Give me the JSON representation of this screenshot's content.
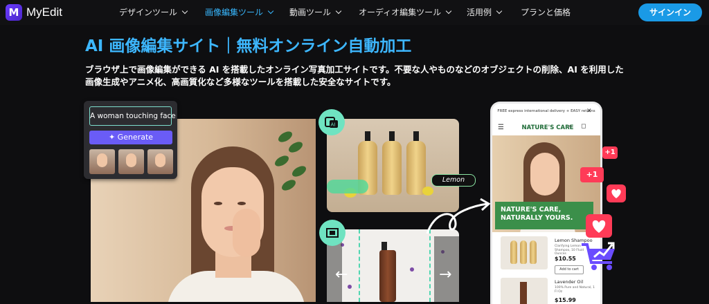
{
  "nav": {
    "logo_text": "MyEdit",
    "items": [
      {
        "label": "デザインツール"
      },
      {
        "label": "画像編集ツール"
      },
      {
        "label": "動画ツール"
      },
      {
        "label": "オーディオ編集ツール"
      },
      {
        "label": "活用例"
      },
      {
        "label": "プランと価格"
      }
    ],
    "signin_label": "サインイン"
  },
  "hero": {
    "title": "AI 画像編集サイト｜無料オンライン自動加工",
    "description": "ブラウザ上で画像編集ができる AI を搭載したオンライン写真加工サイトです。不要な人やものなどのオブジェクトの削除、AI を利用した 画像生成やアニメ化、高画質化など多様なツールを搭載した安全なサイトです。"
  },
  "generate_card": {
    "prompt_value": "A woman touching face",
    "generate_label": "Generate"
  },
  "product_card": {
    "tag_label": "Lemon"
  },
  "phone": {
    "topbar_text": "FREE express international delivery + EASY returns",
    "brand": "NATURE'S CARE",
    "banner_text": "NATURE'S CARE, NATURALLY YOURS.",
    "products": [
      {
        "name": "Lemon Shampoo",
        "desc": "Clarifying Lemon Shampoo, 10 Fluid Ounces",
        "price": "$10.55",
        "add_label": "Add to cart"
      },
      {
        "name": "Lavender Oil",
        "desc": "100% Pure and Natural, 1 Fl Oz",
        "price": "$15.99"
      }
    ]
  },
  "notifications": {
    "plus_one": "+1"
  },
  "colors": {
    "accent": "#3db7ff",
    "signin": "#1a9ae6",
    "generate": "#6a5cf6",
    "notification": "#ff3b57"
  }
}
